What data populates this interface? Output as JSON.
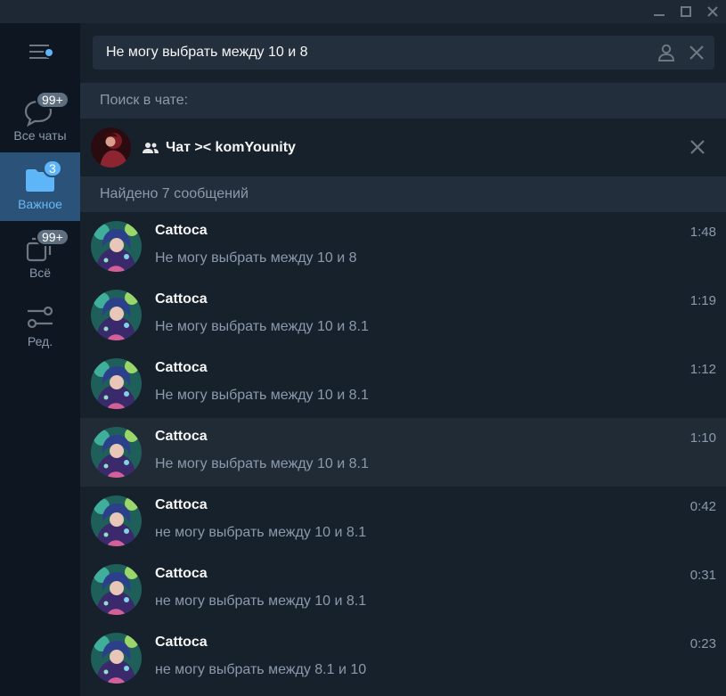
{
  "window": {
    "controls": [
      "minimize-icon",
      "maximize-icon",
      "close-icon"
    ]
  },
  "sidebar": {
    "menu_icon": "hamburger-menu-icon",
    "folders": [
      {
        "label": "Все чаты",
        "badge": "99+",
        "icon": "chat-bubbles-icon",
        "active": false
      },
      {
        "label": "Важное",
        "badge": "3",
        "icon": "folder-icon",
        "active": true
      },
      {
        "label": "Всё",
        "badge": "99+",
        "icon": "chats-stack-icon",
        "active": false
      },
      {
        "label": "Ред.",
        "badge": "",
        "icon": "sliders-icon",
        "active": false
      }
    ]
  },
  "search": {
    "query": "Не могу выбрать между 10 и 8",
    "user_icon": "person-icon",
    "clear_icon": "close-icon"
  },
  "search_in_chat": {
    "header": "Поиск в чате:",
    "chat_title": "Чат >< komYounity",
    "chat_icon": "group-icon"
  },
  "results": {
    "header": "Найдено 7 сообщений",
    "items": [
      {
        "name": "Cattoca",
        "text": "Не могу выбрать между 10 и 8",
        "time": "1:48"
      },
      {
        "name": "Cattoca",
        "text": "Не могу выбрать между 10 и 8.1",
        "time": "1:19"
      },
      {
        "name": "Cattoca",
        "text": "Не могу выбрать между 10 и 8.1",
        "time": "1:12"
      },
      {
        "name": "Cattoca",
        "text": "Не могу выбрать между 10 и 8.1",
        "time": "1:10"
      },
      {
        "name": "Cattoca",
        "text": "не могу выбрать между 10 и 8.1",
        "time": "0:42"
      },
      {
        "name": "Cattoca",
        "text": "не могу выбрать между 10 и 8.1",
        "time": "0:31"
      },
      {
        "name": "Cattoca",
        "text": "не могу выбрать между 8.1 и 10",
        "time": "0:23"
      }
    ]
  },
  "colors": {
    "sidebar_bg": "#0e1621",
    "main_bg": "#17212b",
    "active_folder": "#2b5278",
    "accent": "#5eb5f7",
    "secondary_text": "#8b9aab"
  }
}
